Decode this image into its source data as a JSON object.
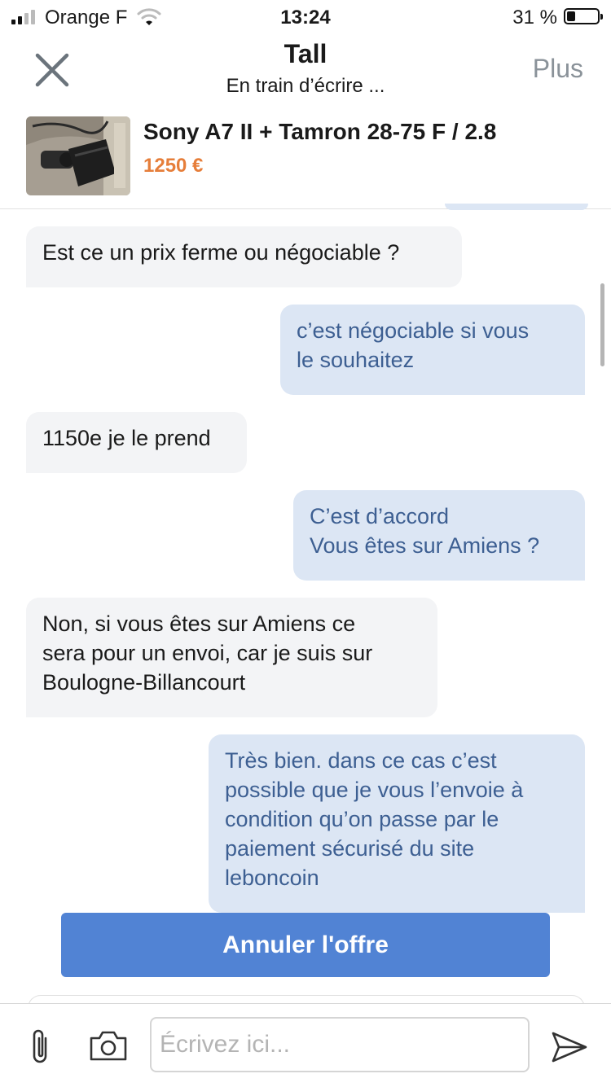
{
  "status_bar": {
    "carrier": "Orange F",
    "time": "13:24",
    "battery": "31 %",
    "battery_level": 0.31
  },
  "header": {
    "title": "Tall",
    "subtitle": "En train d’écrire ...",
    "more_label": "Plus",
    "close_icon": "close-icon"
  },
  "listing": {
    "title": "Sony A7 II + Tamron 28-75 F / 2.8",
    "price": "1250 €"
  },
  "messages": [
    {
      "from": "them",
      "text": "Est ce un prix ferme ou négociable ?"
    },
    {
      "from": "me",
      "text": "c’est négociable si vous\nle souhaitez"
    },
    {
      "from": "them",
      "text": "1150e je le prend"
    },
    {
      "from": "me",
      "text": "C’est d’accord\nVous êtes sur Amiens ?"
    },
    {
      "from": "them",
      "text": "Non, si vous êtes sur Amiens ce\nsera pour un envoi, car je suis sur\nBoulogne-Billancourt"
    },
    {
      "from": "me",
      "text": "Très bien. dans ce cas c’est\npossible que je vous l’envoie à\ncondition qu’on passe par le\npaiement sécurisé du site\nleboncoin"
    }
  ],
  "cancel_offer_label": "Annuler l'offre",
  "composer": {
    "placeholder": "Écrivez ici...",
    "icons": [
      "paperclip-icon",
      "camera-icon",
      "send-icon"
    ]
  },
  "colors": {
    "accent": "#5183d4",
    "price": "#e67e3a",
    "outgoing_bubble": "#dce6f4",
    "outgoing_text": "#3d5f92",
    "incoming_bubble": "#f3f4f6"
  }
}
